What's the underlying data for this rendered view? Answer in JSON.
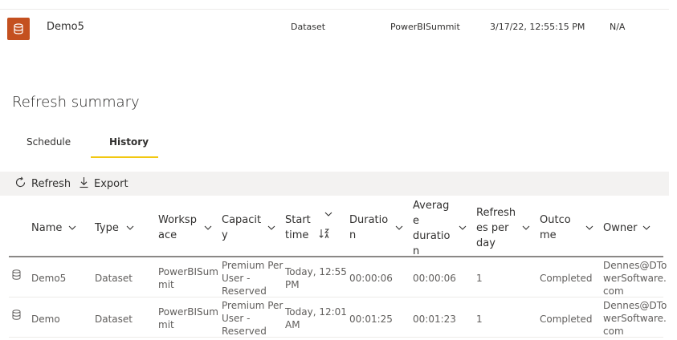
{
  "item": {
    "name": "Demo5",
    "type": "Dataset",
    "workspace": "PowerBISummit",
    "time": "3/17/22, 12:55:15 PM",
    "extra": "N/A",
    "icon": "dataset-icon",
    "icon_bg": "#c4501f"
  },
  "page": {
    "title": "Refresh summary",
    "tabs": [
      {
        "label": "Schedule",
        "active": false
      },
      {
        "label": "History",
        "active": true
      }
    ],
    "accent": "#f2c811"
  },
  "toolbar": {
    "refresh_label": "Refresh",
    "export_label": "Export"
  },
  "table": {
    "headers": {
      "name": "Name",
      "type": "Type",
      "workspace": "Worksp ace",
      "capacity": "Capacit y",
      "start_time": "Start time",
      "duration": "Duratio n",
      "avg_duration": "Averag e duratio n",
      "refreshes": "Refresh es per day",
      "outcome": "Outco me",
      "owner": "Owner"
    },
    "header_lines": {
      "workspace": [
        "Worksp",
        "ace"
      ],
      "capacity": [
        "Capacit",
        "y"
      ],
      "start_time": [
        "Start",
        "time"
      ],
      "duration": [
        "Duratio",
        "n"
      ],
      "avg_duration": [
        "Averag",
        "e",
        "duratio",
        "n"
      ],
      "refreshes": [
        "Refresh",
        "es per",
        "day"
      ],
      "outcome": [
        "Outco",
        "me"
      ]
    },
    "rows": [
      {
        "name": "Demo5",
        "type": "Dataset",
        "workspace": [
          "PowerBISum",
          "mit"
        ],
        "capacity": [
          "Premium Per",
          "User -",
          "Reserved"
        ],
        "start_time": [
          "Today, 12:55",
          "PM"
        ],
        "duration": "00:00:06",
        "avg_duration": "00:00:06",
        "refreshes": "1",
        "outcome": "Completed",
        "owner": [
          "Dennes@DTo",
          "werSoftware.",
          "com"
        ]
      },
      {
        "name": "Demo",
        "type": "Dataset",
        "workspace": [
          "PowerBISum",
          "mit"
        ],
        "capacity": [
          "Premium Per",
          "User -",
          "Reserved"
        ],
        "start_time": [
          "Today, 12:01",
          "AM"
        ],
        "duration": "00:01:25",
        "avg_duration": "00:01:23",
        "refreshes": "1",
        "outcome": "Completed",
        "owner": [
          "Dennes@DTo",
          "werSoftware.",
          "com"
        ]
      }
    ]
  }
}
